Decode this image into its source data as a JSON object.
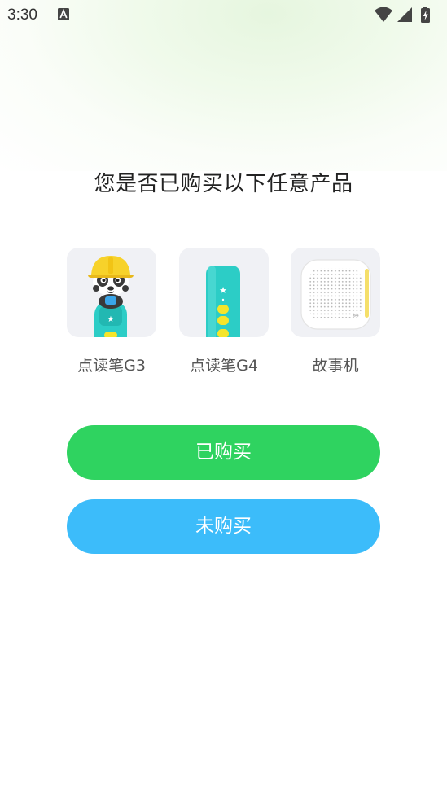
{
  "status_bar": {
    "time": "3:30",
    "notification_icon": "a-letter-icon",
    "icons": [
      "wifi-icon",
      "signal-icon",
      "battery-charging-icon"
    ]
  },
  "title": "您是否已购买以下任意产品",
  "products": [
    {
      "label": "点读笔G3",
      "image": "panda-reading-pen-image"
    },
    {
      "label": "点读笔G4",
      "image": "reading-pen-image"
    },
    {
      "label": "故事机",
      "image": "story-machine-image"
    }
  ],
  "buttons": {
    "bought": "已购买",
    "not_bought": "未购买"
  },
  "colors": {
    "bought_button": "#2fd360",
    "not_bought_button": "#3cbcfa",
    "card_background": "#f0f1f5",
    "pen_teal": "#2ccdc6",
    "pen_yellow": "#f5e52a"
  }
}
